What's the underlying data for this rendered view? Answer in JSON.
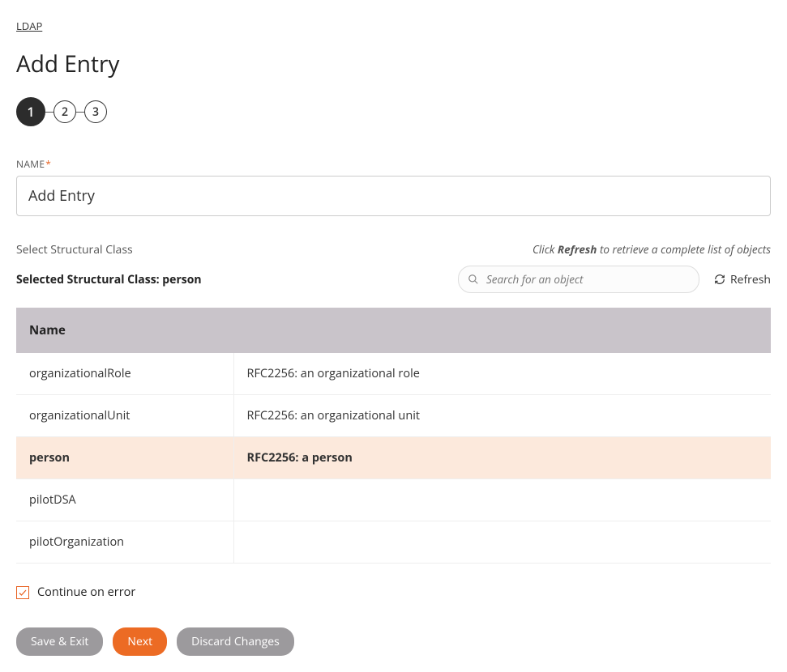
{
  "breadcrumb": {
    "label": "LDAP"
  },
  "page_title": "Add Entry",
  "stepper": {
    "steps": [
      "1",
      "2",
      "3"
    ],
    "active_index": 0
  },
  "name_field": {
    "label": "NAME",
    "required_mark": "*",
    "value": "Add Entry"
  },
  "structural": {
    "select_title": "Select Structural Class",
    "refresh_hint_prefix": "Click ",
    "refresh_hint_bold": "Refresh",
    "refresh_hint_suffix": " to retrieve a complete list of objects",
    "selected_label": "Selected Structural Class: person",
    "search_placeholder": "Search for an object",
    "refresh_button": "Refresh"
  },
  "table": {
    "header_name": "Name",
    "rows": [
      {
        "name": "organizationalRole",
        "desc": "RFC2256: an organizational role",
        "selected": false
      },
      {
        "name": "organizationalUnit",
        "desc": "RFC2256: an organizational unit",
        "selected": false
      },
      {
        "name": "person",
        "desc": "RFC2256: a person",
        "selected": true
      },
      {
        "name": "pilotDSA",
        "desc": "",
        "selected": false
      },
      {
        "name": "pilotOrganization",
        "desc": "",
        "selected": false
      }
    ]
  },
  "continue_checkbox": {
    "checked": true,
    "label": "Continue on error"
  },
  "buttons": {
    "save_exit": "Save & Exit",
    "next": "Next",
    "discard": "Discard Changes"
  }
}
